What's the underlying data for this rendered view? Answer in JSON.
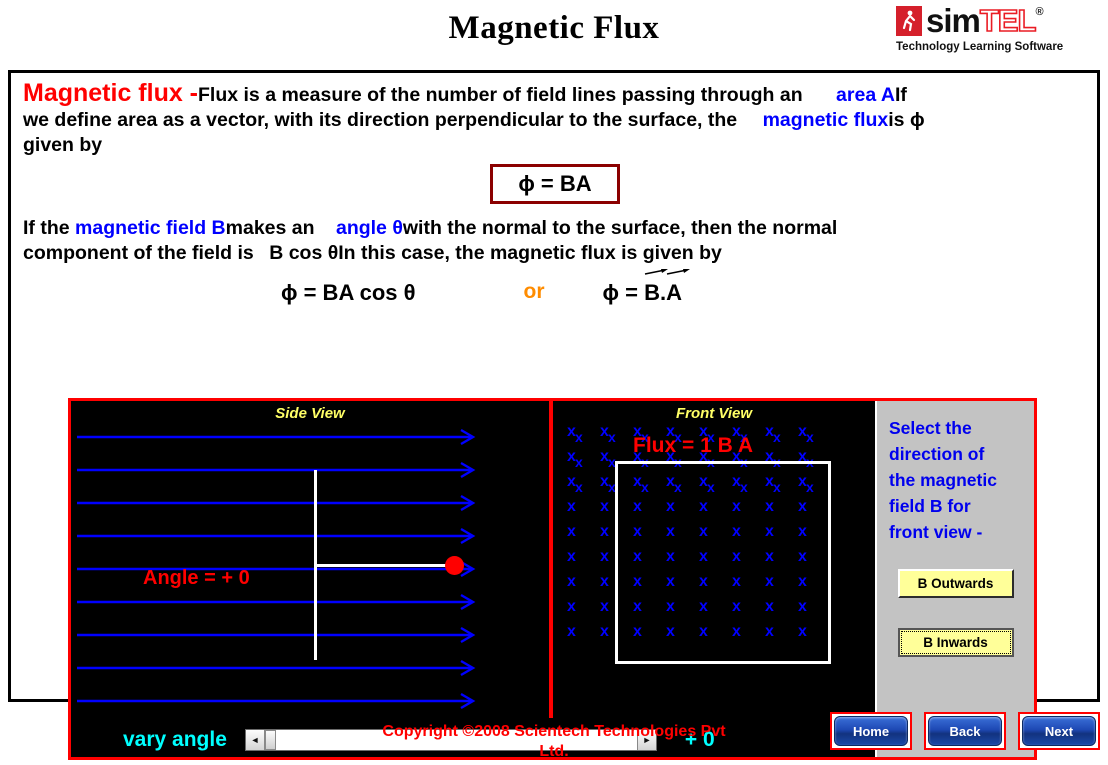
{
  "header": {
    "title": "Magnetic Flux",
    "logo": {
      "primary": "sim",
      "secondary": "TEL",
      "registered": "®",
      "tagline": "Technology Learning  Software"
    }
  },
  "lesson": {
    "term": "Magnetic flux -",
    "line1_a": "Flux is a measure of the number of field lines passing through an",
    "line1_blue": "area A",
    "line1_b": "If",
    "line2_a": "we define area as a vector, with its direction perpendicular to the surface, the",
    "line2_blue": "magnetic flux",
    "line2_b": "is ϕ",
    "line3": "given by",
    "equation_box": "ϕ = BA",
    "line4_a": "If the",
    "line4_blue1": "magnetic field B",
    "line4_b": "makes an",
    "line4_blue2": "angle θ",
    "line4_c": "with the normal to the surface, then the normal",
    "line5_a": "component of the field is",
    "line5_b": "B cos θ",
    "line5_c": "In this case, the magnetic flux is given by",
    "equation_a": "ϕ = BA cos θ",
    "equation_or": "or",
    "equation_b_prefix": "ϕ =",
    "equation_b_vec1": "B",
    "equation_b_dot": ".",
    "equation_b_vec2": "A"
  },
  "simulation": {
    "side_view": {
      "label": "Side View",
      "angle_text": "Angle = + 0",
      "field_line_count": 9,
      "field_line_color": "#0000ff"
    },
    "front_view": {
      "label": "Front View",
      "flux_text": "Flux = 1 B A",
      "marker_glyph": "x",
      "marker_color": "#0000ff",
      "grid_cols": 8,
      "grid_rows": 9
    },
    "controls": {
      "prompt_lines": [
        "Select the",
        "direction of",
        "the magnetic",
        "field B for",
        "front view -"
      ],
      "button_outwards": "B Outwards",
      "button_inwards": "B Inwards",
      "selected": "B Inwards"
    },
    "slider": {
      "label": "vary angle",
      "value_text": "+ 0",
      "value": 0,
      "min": -90,
      "max": 90,
      "left_arrow": "◄",
      "right_arrow": "►"
    }
  },
  "footer": {
    "copyright_line1": "Copyright ©2008 Scientech Technologies Pvt",
    "copyright_line2": "Ltd.",
    "nav": {
      "home": "Home",
      "back": "Back",
      "next": "Next"
    }
  },
  "colors": {
    "accent_red": "#ff0000",
    "accent_blue": "#0000ff",
    "label_yellow": "#ffff66",
    "cyan": "#00ffff",
    "button_yellow": "#ffff99",
    "panel_gray": "#c3c3c3"
  }
}
